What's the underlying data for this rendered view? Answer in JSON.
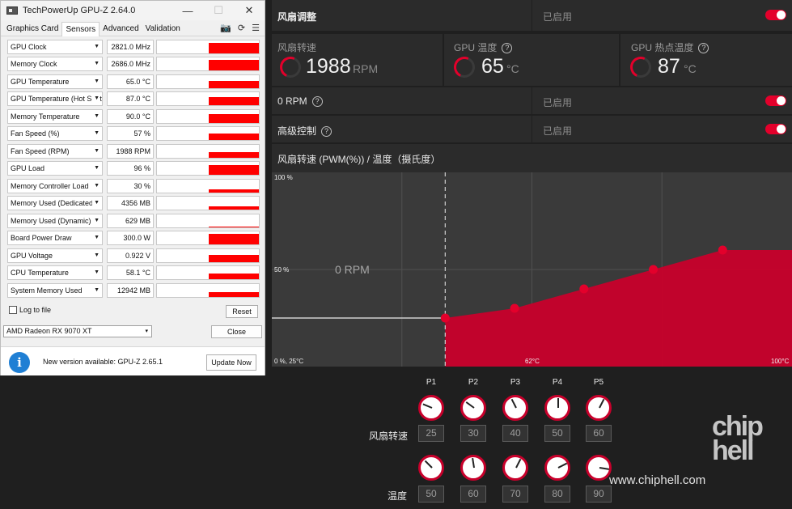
{
  "gpuz": {
    "title": "TechPowerUp GPU-Z 2.64.0",
    "tabs": [
      "Graphics Card",
      "Sensors",
      "Advanced",
      "Validation"
    ],
    "sensors": [
      {
        "name": "GPU Clock",
        "value": "2821.0 MHz",
        "level": 1.0
      },
      {
        "name": "Memory Clock",
        "value": "2686.0 MHz",
        "level": 1.0
      },
      {
        "name": "GPU Temperature",
        "value": "65.0 °C",
        "level": 0.72
      },
      {
        "name": "GPU Temperature (Hot Spot)",
        "value": "87.0 °C",
        "level": 0.8
      },
      {
        "name": "Memory Temperature",
        "value": "90.0 °C",
        "level": 0.82
      },
      {
        "name": "Fan Speed (%)",
        "value": "57 %",
        "level": 0.6
      },
      {
        "name": "Fan Speed (RPM)",
        "value": "1988 RPM",
        "level": 0.55
      },
      {
        "name": "GPU Load",
        "value": "96 %",
        "level": 0.96
      },
      {
        "name": "Memory Controller Load",
        "value": "30 %",
        "level": 0.3
      },
      {
        "name": "Memory Used (Dedicated)",
        "value": "4356 MB",
        "level": 0.28
      },
      {
        "name": "Memory Used (Dynamic)",
        "value": "629 MB",
        "level": 0.06
      },
      {
        "name": "Board Power Draw",
        "value": "300.0 W",
        "level": 0.98
      },
      {
        "name": "GPU Voltage",
        "value": "0.922 V",
        "level": 0.7
      },
      {
        "name": "CPU Temperature",
        "value": "58.1 °C",
        "level": 0.5
      },
      {
        "name": "System Memory Used",
        "value": "12942 MB",
        "level": 0.45
      }
    ],
    "log_label": "Log to file",
    "reset_label": "Reset",
    "gpu_select": "AMD Radeon RX 9070 XT",
    "close_label": "Close",
    "notice_text": "New version available: GPU-Z 2.65.1",
    "update_label": "Update Now"
  },
  "amd": {
    "fan_tuning_label": "风扇调整",
    "enabled_label": "已启用",
    "fan_speed_label": "风扇转速",
    "fan_speed_value": "1988",
    "fan_speed_unit": "RPM",
    "gpu_temp_label": "GPU 温度",
    "gpu_temp_value": "65",
    "temp_unit": "°C",
    "hotspot_label": "GPU 热点温度",
    "hotspot_value": "87",
    "zero_rpm_label": "0 RPM",
    "advanced_label": "高级控制",
    "curve_title": "风扇转速 (PWM(%)) / 温度（摄氏度）",
    "row_fan_label": "风扇转速",
    "row_temp_label": "温度",
    "points": [
      "P1",
      "P2",
      "P3",
      "P4",
      "P5"
    ],
    "fan_values": [
      "25",
      "30",
      "40",
      "50",
      "60"
    ],
    "temp_values": [
      "50",
      "60",
      "70",
      "80",
      "90"
    ]
  },
  "chart_data": {
    "type": "area",
    "y_top_label": "100 %",
    "y_mid_label": "50 %",
    "origin_label": "0 %, 25°C",
    "x_mid_label": "62°C",
    "x_end_label": "100°C",
    "zero_rpm_label": "0 RPM",
    "x": [
      50,
      60,
      70,
      80,
      90
    ],
    "y": [
      25,
      30,
      40,
      50,
      60
    ],
    "xlim": [
      25,
      100
    ],
    "ylim": [
      0,
      100
    ],
    "zero_rpm_until": 62,
    "color": "#c8002b"
  },
  "watermark": {
    "logo_text": "chip hell",
    "site": "www.chiphell.com"
  }
}
